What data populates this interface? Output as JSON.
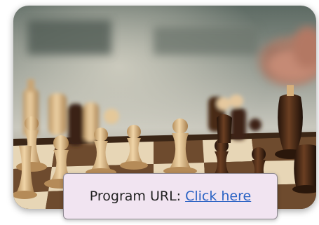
{
  "photo": {
    "subject": "chess-board-photo",
    "colors": {
      "board_light": "#e7d6b6",
      "board_dark": "#6e4b2e",
      "piece_light": "#d9b88a",
      "piece_dark": "#3a2215",
      "background_blur": "#8c8f87"
    }
  },
  "program": {
    "label": "Program URL:",
    "link_text": "Click here"
  },
  "colors": {
    "box_background": "#f1e4f1",
    "box_border": "#8f8a92",
    "link": "#2b63c4"
  }
}
